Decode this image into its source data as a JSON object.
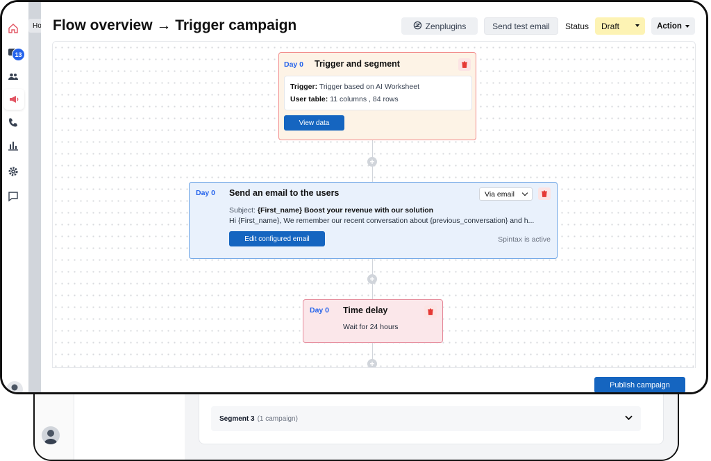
{
  "header": {
    "title": "Flow overview → Trigger campaign",
    "zen_label": "Zenplugins",
    "send_test_label": "Send test email",
    "status_label": "Status",
    "status_value": "Draft",
    "action_label": "Action"
  },
  "sidebar": {
    "tooltip": "Ho",
    "badge_count": "13",
    "icons": [
      "home-icon",
      "inbox-icon",
      "users-icon",
      "megaphone-icon",
      "phone-icon",
      "chart-icon",
      "gear-icon",
      "chat-icon"
    ]
  },
  "flow": {
    "trigger": {
      "day": "Day 0",
      "title": "Trigger and segment",
      "trigger_label": "Trigger:",
      "trigger_value": "Trigger based on AI Worksheet",
      "table_label": "User table:",
      "table_value": "11 columns , 84 rows",
      "button": "View data"
    },
    "email": {
      "day": "Day 0",
      "title": "Send an email to the users",
      "channel": "Via email",
      "subject_label": "Subject:",
      "subject_value": "{First_name} Boost your revenue with our solution",
      "body": "Hi {First_name}, We remember our recent conversation about {previous_conversation} and h...",
      "button": "Edit configured email",
      "spintax": "Spintax is active"
    },
    "delay": {
      "day": "Day 0",
      "title": "Time delay",
      "subtitle": "Wait for 24 hours"
    }
  },
  "footer": {
    "publish_label": "Publish campaign"
  },
  "background": {
    "segment_title": "Segment 3",
    "segment_count": "(1 campaign)"
  },
  "colors": {
    "primary": "#1565c0",
    "accent_blue": "#2563eb",
    "status_bg": "#fdf3b4",
    "trigger_bg": "#fdf3e6",
    "email_bg": "#e9f1fc",
    "delay_bg": "#fbe7ea",
    "danger": "#e53935"
  }
}
